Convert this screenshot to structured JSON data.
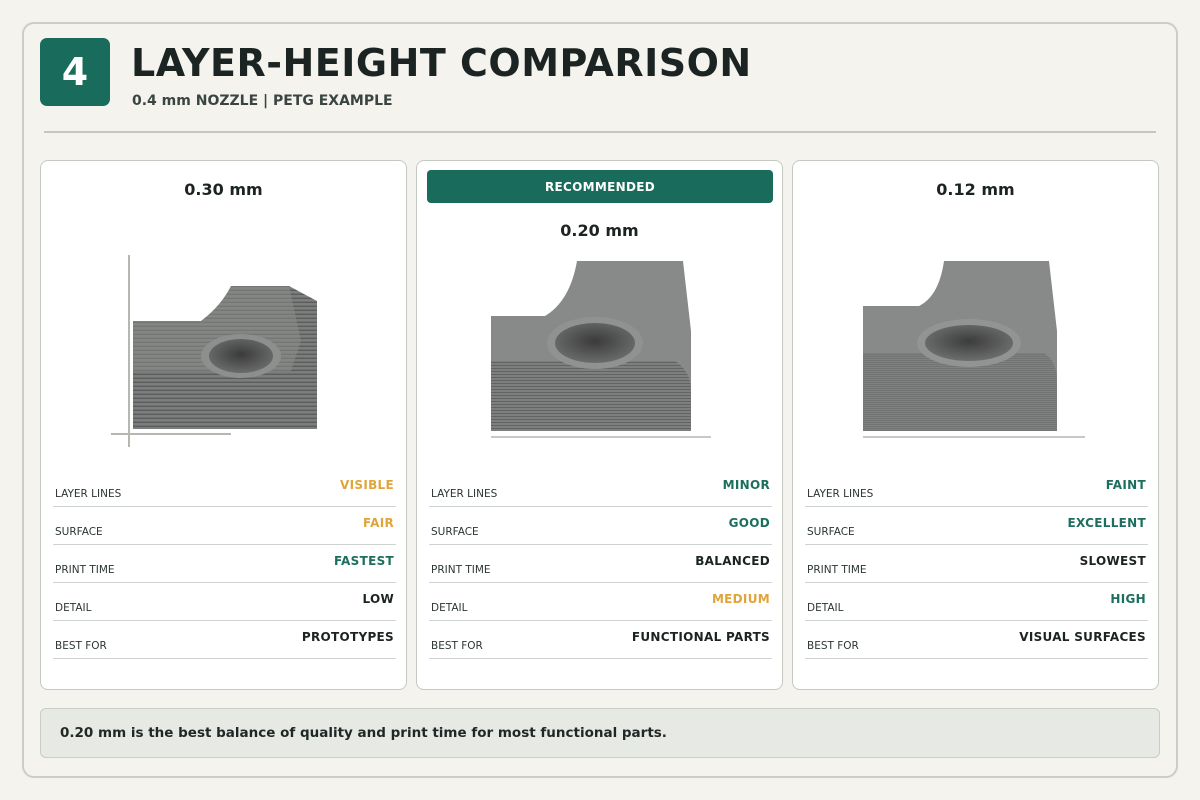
{
  "header": {
    "step_number": "4",
    "title": "LAYER-HEIGHT COMPARISON",
    "subtitle": "0.4 mm NOZZLE | PETG EXAMPLE"
  },
  "cards": [
    {
      "title": "0.30 mm",
      "banner": "",
      "image_name": "petg-part-photo",
      "attributes": [
        {
          "label": "LAYER LINES",
          "value": "VISIBLE",
          "color": "#e0a53a"
        },
        {
          "label": "SURFACE",
          "value": "FAIR",
          "color": "#e0a53a"
        },
        {
          "label": "PRINT TIME",
          "value": "FASTEST",
          "color": "#1d6e5e"
        },
        {
          "label": "DETAIL",
          "value": "LOW",
          "color": "#1c2422"
        },
        {
          "label": "BEST FOR",
          "value": "PROTOTYPES",
          "color": "#1c2422"
        }
      ]
    },
    {
      "title": "0.20 mm",
      "banner": "RECOMMENDED",
      "image_name": "petg-part-photo",
      "attributes": [
        {
          "label": "LAYER LINES",
          "value": "MINOR",
          "color": "#1d6e5e"
        },
        {
          "label": "SURFACE",
          "value": "GOOD",
          "color": "#1d6e5e"
        },
        {
          "label": "PRINT TIME",
          "value": "BALANCED",
          "color": "#1c2422"
        },
        {
          "label": "DETAIL",
          "value": "MEDIUM",
          "color": "#e0a53a"
        },
        {
          "label": "BEST FOR",
          "value": "FUNCTIONAL PARTS",
          "color": "#1c2422"
        }
      ]
    },
    {
      "title": "0.12 mm",
      "banner": "",
      "image_name": "petg-part-photo",
      "attributes": [
        {
          "label": "LAYER LINES",
          "value": "FAINT",
          "color": "#1d6e5e"
        },
        {
          "label": "SURFACE",
          "value": "EXCELLENT",
          "color": "#1d6e5e"
        },
        {
          "label": "PRINT TIME",
          "value": "SLOWEST",
          "color": "#1c2422"
        },
        {
          "label": "DETAIL",
          "value": "HIGH",
          "color": "#1d6e5e"
        },
        {
          "label": "BEST FOR",
          "value": "VISUAL SURFACES",
          "color": "#1c2422"
        }
      ]
    }
  ],
  "footer": {
    "note": "0.20 mm is the best balance of quality and print time for most functional parts."
  },
  "colors": {
    "accent": "#196b5b",
    "amber": "#e0a53a",
    "background": "#f4f3ee"
  }
}
